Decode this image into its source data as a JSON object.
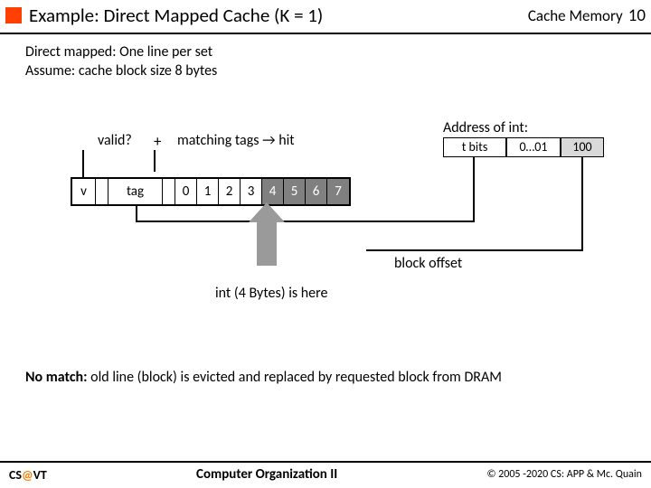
{
  "header": {
    "title": "Example: Direct Mapped Cache (K = 1)",
    "section": "Cache Memory",
    "page": "10"
  },
  "intro": {
    "line1": "Direct mapped: One line per set",
    "line2": "Assume: cache block size 8 bytes"
  },
  "labels": {
    "valid": "valid?",
    "plus": "+",
    "match": "matching tags → hit",
    "addr_title": "Address of int:",
    "tbits": "t bits",
    "setidx": "0…01",
    "offset": "100",
    "block_offset": "block offset",
    "int_here": "int (4 Bytes) is here"
  },
  "cache": {
    "v": "v",
    "tag": "tag",
    "bytes": [
      "0",
      "1",
      "2",
      "3",
      "4",
      "5",
      "6",
      "7"
    ]
  },
  "nomatch": {
    "bold": "No match:",
    "rest": " old line (block) is evicted and replaced by requested block from DRAM"
  },
  "footer": {
    "brand_cs": "CS",
    "brand_at": "@",
    "brand_vt": "VT",
    "course": "Computer Organization II",
    "copy": "© 2005 -2020 CS: APP & Mc. Quain"
  }
}
